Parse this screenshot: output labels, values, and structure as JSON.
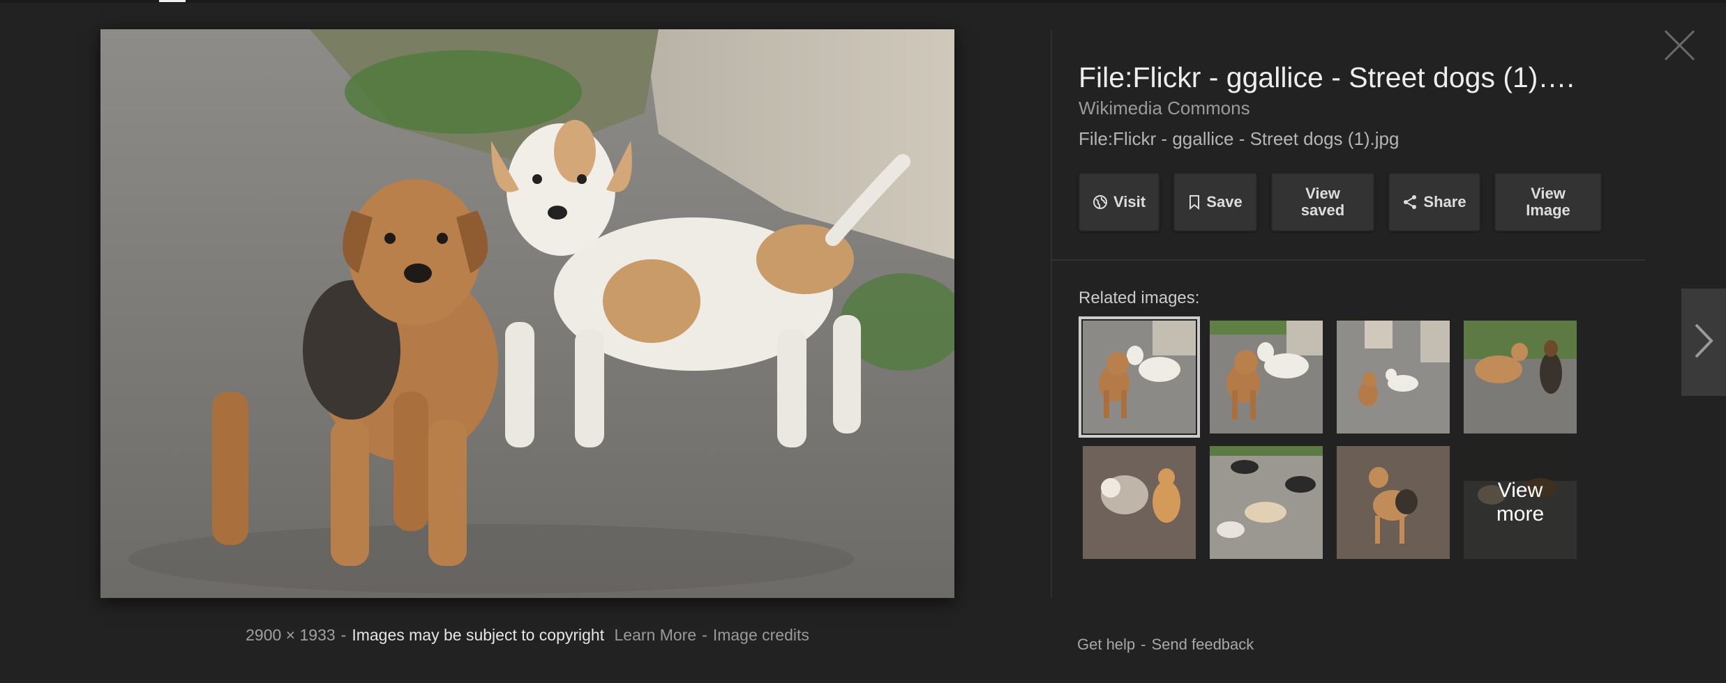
{
  "panel": {
    "title": "File:Flickr - ggallice - Street dogs (1)….",
    "source": "Wikimedia Commons",
    "filename": "File:Flickr - ggallice - Street dogs (1).jpg"
  },
  "actions": {
    "visit": "Visit",
    "save": "Save",
    "view_saved_line1": "View",
    "view_saved_line2": "saved",
    "share": "Share",
    "view_image_line1": "View",
    "view_image_line2": "Image"
  },
  "related": {
    "label": "Related images:",
    "view_more_line1": "View",
    "view_more_line2": "more"
  },
  "caption": {
    "dimensions": "2900 × 1933",
    "separator": "-",
    "copyright": "Images may be subject to copyright",
    "learn_more": "Learn More",
    "image_credits": "Image credits"
  },
  "footer": {
    "get_help": "Get help",
    "separator": "-",
    "send_feedback": "Send feedback"
  },
  "icons": {
    "visit": "globe-icon",
    "save": "bookmark-icon",
    "share": "share-icon",
    "close": "close-icon",
    "next": "chevron-right-icon"
  },
  "colors": {
    "background": "#222222",
    "button": "#333333",
    "text": "#eeeeee",
    "muted": "#9b9b9b"
  }
}
